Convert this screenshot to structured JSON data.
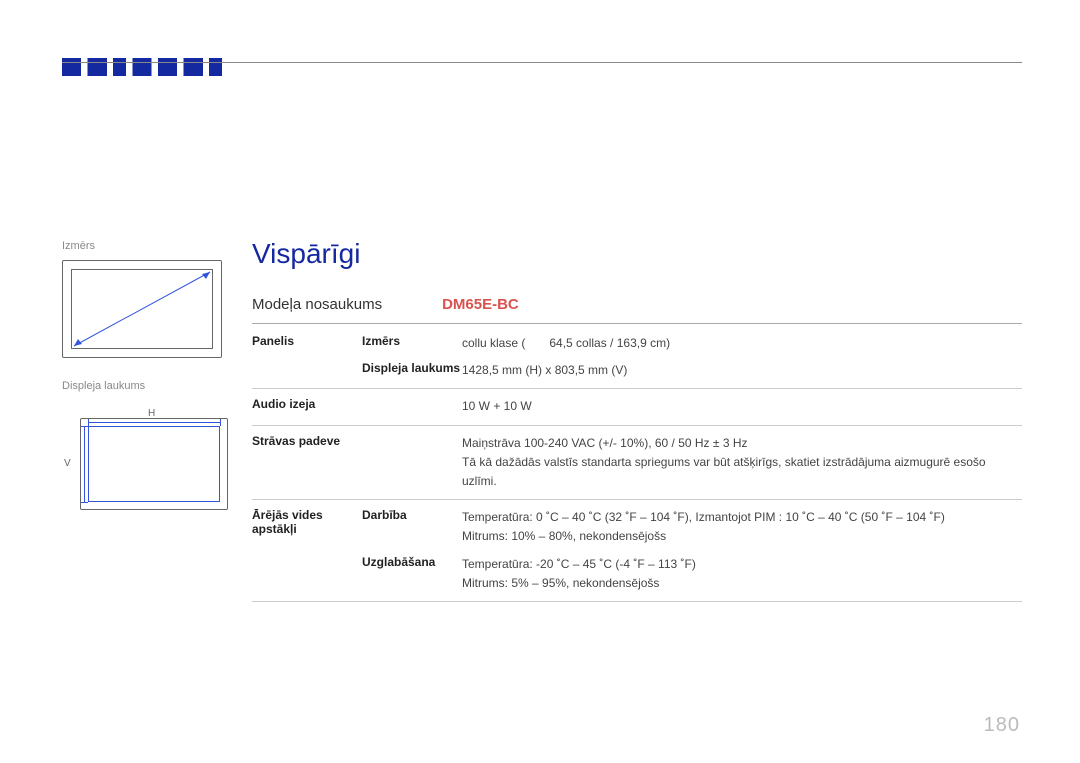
{
  "page_number": "180",
  "sidebar": {
    "label1": "Izmērs",
    "label2": "Displeja laukums",
    "h_label": "H",
    "v_label": "V"
  },
  "main": {
    "title": "Vispārīgi",
    "model_label": "Modeļa nosaukums",
    "model_value": "DM65E-BC",
    "rows": [
      {
        "cat": "Panelis",
        "key": "Izmērs",
        "val": "collu klase (  64,5 collas / 163,9 cm)"
      },
      {
        "cat": "",
        "key": "Displeja laukums",
        "val": "1428,5 mm (H) x 803,5 mm (V)"
      },
      {
        "cat": "Audio izeja",
        "key": "",
        "val": "10 W + 10 W"
      },
      {
        "cat": "Strāvas padeve",
        "key": "",
        "val": "Maiņstrāva 100-240 VAC (+/- 10%), 60 / 50 Hz ± 3 Hz\nTā kā dažādās valstīs standarta spriegums var būt atšķirīgs, skatiet izstrādājuma aizmugurē esošo uzlīmi."
      },
      {
        "cat": "Ārējās vides apstākļi",
        "key": "Darbība",
        "val": "Temperatūra: 0 ˚C – 40 ˚C (32 ˚F – 104 ˚F), Izmantojot PIM : 10 ˚C – 40 ˚C (50 ˚F – 104 ˚F)\nMitrums: 10% – 80%, nekondensējošs"
      },
      {
        "cat": "",
        "key": "Uzglabāšana",
        "val": "Temperatūra: -20 ˚C – 45 ˚C (-4 ˚F – 113 ˚F)\nMitrums: 5% – 95%, nekondensējošs"
      }
    ]
  }
}
